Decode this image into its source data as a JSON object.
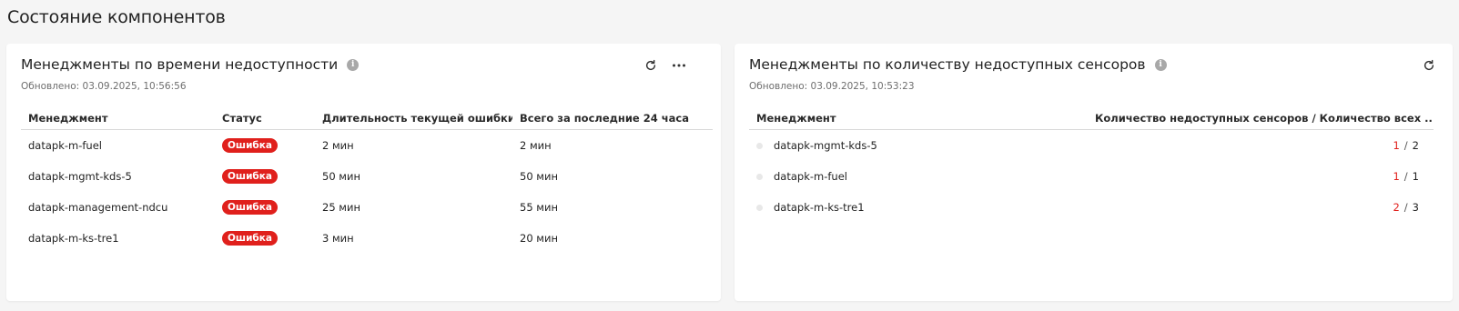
{
  "page_title": "Состояние компонентов",
  "left_panel": {
    "title": "Менеджменты по времени недоступности",
    "updated": "Обновлено: 03.09.2025, 10:56:56",
    "columns": [
      "Менеджмент",
      "Статус",
      "Длительность текущей ошибки",
      "Всего за последние 24 часа"
    ],
    "rows": [
      {
        "name": "datapk-m-fuel",
        "status": "Ошибка",
        "current": "2 мин",
        "total": "2 мин"
      },
      {
        "name": "datapk-mgmt-kds-5",
        "status": "Ошибка",
        "current": "50 мин",
        "total": "50 мин"
      },
      {
        "name": "datapk-management-ndcu",
        "status": "Ошибка",
        "current": "25 мин",
        "total": "55 мин"
      },
      {
        "name": "datapk-m-ks-tre1",
        "status": "Ошибка",
        "current": "3 мин",
        "total": "20 мин"
      }
    ],
    "icons": {
      "info": "info-icon",
      "refresh": "refresh-icon",
      "more": "more-icon"
    }
  },
  "right_panel": {
    "title": "Менеджменты по количеству недоступных сенсоров",
    "updated": "Обновлено: 03.09.2025, 10:53:23",
    "columns": [
      "Менеджмент",
      "Количество недоступных сенсоров / Количество всех ..."
    ],
    "rows": [
      {
        "name": "datapk-mgmt-kds-5",
        "unavailable": "1",
        "total": "2"
      },
      {
        "name": "datapk-m-fuel",
        "unavailable": "1",
        "total": "1"
      },
      {
        "name": "datapk-m-ks-tre1",
        "unavailable": "2",
        "total": "3"
      }
    ],
    "separator": "/",
    "icons": {
      "info": "info-icon",
      "refresh": "refresh-icon"
    }
  },
  "colors": {
    "error": "#e0201c",
    "background": "#f5f5f5"
  }
}
